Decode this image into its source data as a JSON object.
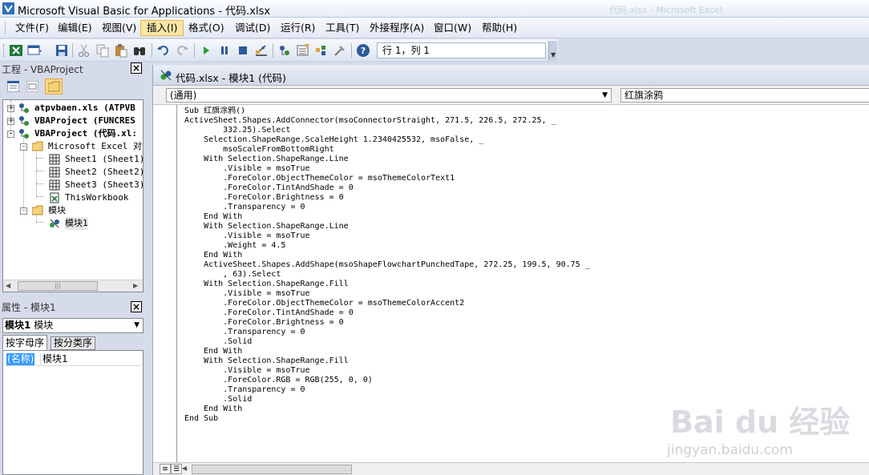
{
  "window": {
    "title": "Microsoft Visual Basic for Applications - 代码.xlsx",
    "ghost_title": "代码.xlsx - Microsoft Excel"
  },
  "menu": [
    "文件(F)",
    "编辑(E)",
    "视图(V)",
    "插入(I)",
    "格式(O)",
    "调试(D)",
    "运行(R)",
    "工具(T)",
    "外接程序(A)",
    "窗口(W)",
    "帮助(H)"
  ],
  "menu_active_index": 3,
  "toolbar": {
    "icons": [
      "excel-icon",
      "insert-userform-icon",
      "save-icon",
      "cut-icon",
      "copy-icon",
      "paste-icon",
      "find-icon",
      "undo-icon",
      "redo-icon",
      "run-icon",
      "break-icon",
      "reset-icon",
      "design-mode-icon",
      "project-explorer-icon",
      "properties-icon",
      "object-browser-icon",
      "toolbox-icon",
      "help-icon"
    ],
    "position": "行 1，列 1"
  },
  "project": {
    "title": "工程 - VBAProject",
    "tree": [
      {
        "label": "atpvbaen.xls (ATPVB",
        "bold": true,
        "level": 0,
        "toggle": "+",
        "icon": "vba-project-icon"
      },
      {
        "label": "VBAProject (FUNCRES",
        "bold": true,
        "level": 0,
        "toggle": "+",
        "icon": "vba-project-icon"
      },
      {
        "label": "VBAProject (代码.xl:",
        "bold": true,
        "level": 0,
        "toggle": "-",
        "icon": "vba-project-icon"
      },
      {
        "label": "Microsoft Excel 对象",
        "bold": false,
        "level": 1,
        "toggle": "-",
        "icon": "folder-icon"
      },
      {
        "label": "Sheet1 (Sheet1)",
        "bold": false,
        "level": 2,
        "toggle": "",
        "icon": "sheet-icon"
      },
      {
        "label": "Sheet2 (Sheet2)",
        "bold": false,
        "level": 2,
        "toggle": "",
        "icon": "sheet-icon"
      },
      {
        "label": "Sheet3 (Sheet3)",
        "bold": false,
        "level": 2,
        "toggle": "",
        "icon": "sheet-icon"
      },
      {
        "label": "ThisWorkbook",
        "bold": false,
        "level": 2,
        "toggle": "",
        "icon": "workbook-icon"
      },
      {
        "label": "模块",
        "bold": false,
        "level": 1,
        "toggle": "-",
        "icon": "folder-icon"
      },
      {
        "label": "模块1",
        "bold": false,
        "level": 2,
        "toggle": "",
        "icon": "module-icon",
        "selected": true
      }
    ]
  },
  "properties": {
    "title": "属性 - 模块1",
    "object_name": "模块1",
    "object_type": "模块",
    "tabs": [
      "按字母序",
      "按分类序"
    ],
    "rows": [
      {
        "key": "(名称)",
        "value": "模块1"
      }
    ]
  },
  "code_window": {
    "title": "代码.xlsx - 模块1 (代码)",
    "object_combo": "(通用)",
    "proc_combo": "红旗涂鸦",
    "code": "Sub 红旗涂鸦()\nActiveSheet.Shapes.AddConnector(msoConnectorStraight, 271.5, 226.5, 272.25, _\n        332.25).Select\n    Selection.ShapeRange.ScaleHeight 1.2340425532, msoFalse, _\n        msoScaleFromBottomRight\n    With Selection.ShapeRange.Line\n        .Visible = msoTrue\n        .ForeColor.ObjectThemeColor = msoThemeColorText1\n        .ForeColor.TintAndShade = 0\n        .ForeColor.Brightness = 0\n        .Transparency = 0\n    End With\n    With Selection.ShapeRange.Line\n        .Visible = msoTrue\n        .Weight = 4.5\n    End With\n    ActiveSheet.Shapes.AddShape(msoShapeFlowchartPunchedTape, 272.25, 199.5, 90.75 _\n        , 63).Select\n    With Selection.ShapeRange.Fill\n        .Visible = msoTrue\n        .ForeColor.ObjectThemeColor = msoThemeColorAccent2\n        .ForeColor.TintAndShade = 0\n        .ForeColor.Brightness = 0\n        .Transparency = 0\n        .Solid\n    End With\n    With Selection.ShapeRange.Fill\n        .Visible = msoTrue\n        .ForeColor.RGB = RGB(255, 0, 0)\n        .Transparency = 0\n        .Solid\n    End With\nEnd Sub"
  },
  "watermark": {
    "logo": "Bai du 经验",
    "url": "jingyan.baidu.com"
  },
  "colors": {
    "chrome": "#d6dbe9",
    "menu_active": "#fbe6a6",
    "selection": "#3399ff"
  }
}
